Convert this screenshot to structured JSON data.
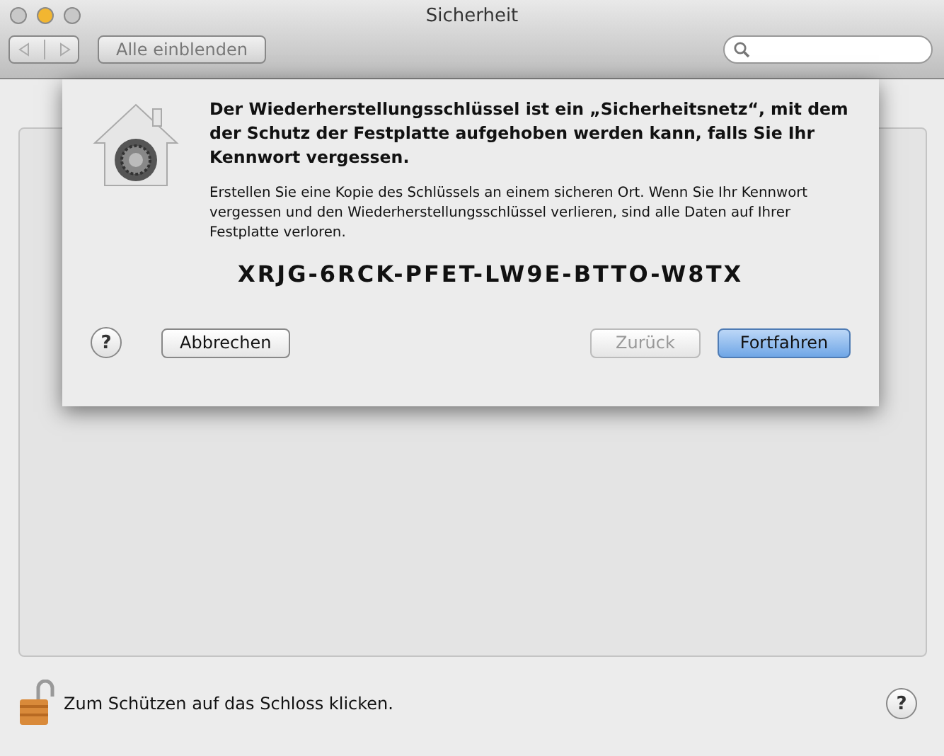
{
  "window": {
    "title": "Sicherheit",
    "controls": [
      {
        "kind": "close"
      },
      {
        "kind": "minimize"
      },
      {
        "kind": "zoom"
      }
    ]
  },
  "toolbar": {
    "back_disabled": true,
    "forward_disabled": true,
    "show_all": "Alle einblenden"
  },
  "sheet": {
    "heading": "Der Wiederherstellungsschlüssel ist ein „Sicherheitsnetz“, mit dem der Schutz der Festplatte aufgehoben werden kann, falls Sie Ihr Kennwort vergessen.",
    "body": "Erstellen Sie eine Kopie des Schlüssels an einem sicheren Ort. Wenn Sie Ihr Kennwort vergessen und den Wiederherstellungsschlüssel verlieren, sind alle Daten auf Ihrer Festplatte verloren.",
    "key": "XRJG-6RCK-PFET-LW9E-BTTO-W8TX",
    "help": "?",
    "buttons": [
      {
        "label": "Abbrechen",
        "kind": "normal",
        "disabled": false
      },
      {
        "label": "Zurück",
        "kind": "normal",
        "disabled": true
      },
      {
        "label": "Fortfahren",
        "kind": "default",
        "disabled": false
      }
    ]
  },
  "footer": {
    "lock_text": "Zum Schützen auf das Schloss klicken.",
    "help": "?"
  }
}
